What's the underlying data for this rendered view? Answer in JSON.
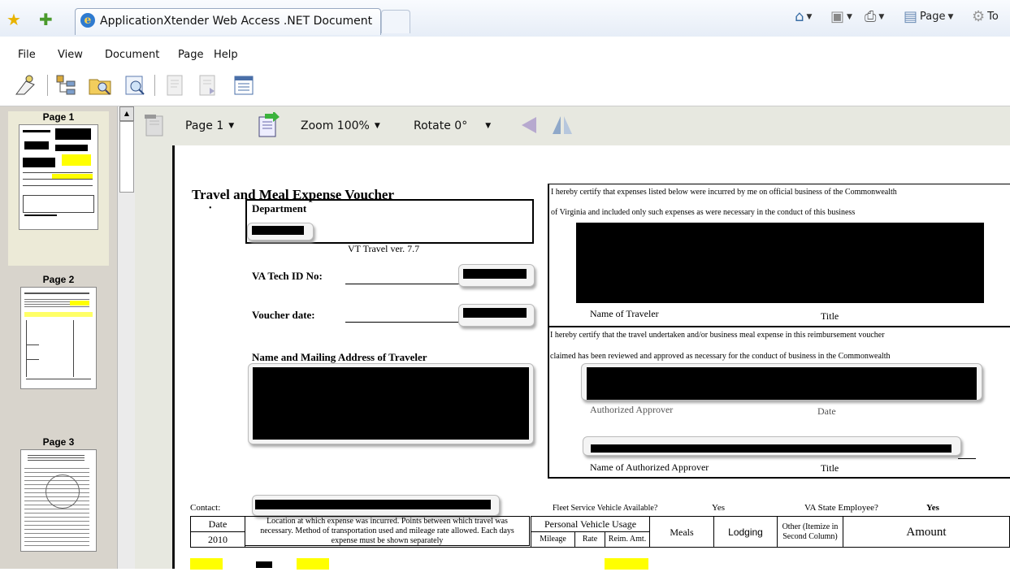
{
  "browser": {
    "tab_title": "ApplicationXtender Web Access .NET Document",
    "commands": {
      "page": "Page",
      "tools": "To"
    }
  },
  "menu": [
    "File",
    "View",
    "Document",
    "Page",
    "Help"
  ],
  "thumbnails": {
    "pages": [
      "Page 1",
      "Page 2",
      "Page 3"
    ],
    "selected": 0
  },
  "viewer": {
    "page_select": "Page 1",
    "zoom_select": "Zoom 100%",
    "rotate_select": "Rotate 0°"
  },
  "document": {
    "title": "Travel and Meal Expense Voucher",
    "department_label": "Department",
    "version": "VT Travel ver. 7.7",
    "vatech_label": "VA Tech ID No:",
    "voucher_date_label": "Voucher date:",
    "name_address_label": "Name and Mailing Address of Traveler",
    "certify_1_line1": "I hereby certify that expenses listed below were incurred by me on official business of the Commonwealth",
    "certify_1_line2": "of Virginia and included only such expenses as were necessary in the conduct of this business",
    "name_of_traveler": "Name of Traveler",
    "title_1": "Title",
    "certify_2_line1": "I hereby certify that the travel undertaken and/or business meal expense in this reimbursement voucher",
    "certify_2_line2": "claimed has been reviewed and approved as necessary for the conduct of business in the Commonwealth",
    "authorized_approver": "Authorized Approver",
    "date_label": "Date",
    "name_of_authorized_approver": "Name of Authorized Approver",
    "title_2": "Title",
    "contact_label": "Contact:",
    "fleet_label": "Fleet Service Vehicle Available?",
    "fleet_value": "Yes",
    "state_employee_label": "VA State Employee?",
    "state_employee_value": "Yes",
    "table": {
      "date_header": "Date",
      "year": "2010",
      "location_header": "Location at which expense was incurred. Points between which travel was necessary. Method of transportation used and mileage rate allowed. Each days expense must be shown separately",
      "personal_vehicle": "Personal Vehicle Usage",
      "mileage": "Mileage",
      "rate": "Rate",
      "reim_amt": "Reim. Amt.",
      "meals": "Meals",
      "lodging": "Lodging",
      "other": "Other (Itemize in Second Column)",
      "amount": "Amount"
    }
  },
  "colors": {
    "highlight": "#ffff00",
    "toolbar_bg": "#e7e8e0",
    "thumb_pane": "#d8d4cc"
  }
}
